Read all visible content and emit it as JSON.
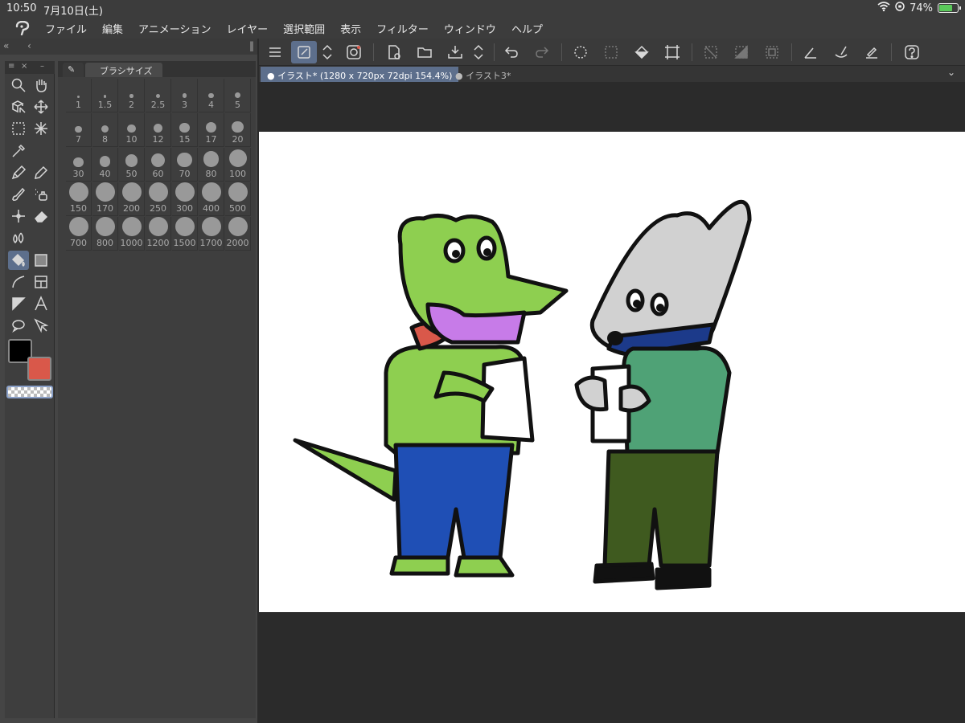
{
  "status": {
    "time": "10:50",
    "date": "7月10日(土)",
    "battery": "74%",
    "battery_level": 0.74
  },
  "menu": [
    "ファイル",
    "編集",
    "アニメーション",
    "レイヤー",
    "選択範囲",
    "表示",
    "フィルター",
    "ウィンドウ",
    "ヘルプ"
  ],
  "brush_panel": {
    "tab_label": "ブラシサイズ",
    "sizes": [
      "1",
      "1.5",
      "2",
      "2.5",
      "3",
      "4",
      "5",
      "7",
      "8",
      "10",
      "12",
      "15",
      "17",
      "20",
      "30",
      "40",
      "50",
      "60",
      "70",
      "80",
      "100",
      "150",
      "170",
      "200",
      "250",
      "300",
      "400",
      "500",
      "700",
      "800",
      "1000",
      "1200",
      "1500",
      "1700",
      "2000"
    ]
  },
  "doc_tabs": [
    {
      "label": "● イラスト* (1280 x 720px 72dpi 154.4%)",
      "active": true
    },
    {
      "label": "● イラスト3*",
      "active": false
    }
  ],
  "colors": {
    "main": "#000000",
    "sub": "#d9584a",
    "accent": "#5d6f8c"
  },
  "icons": {
    "tools": [
      "zoom",
      "hand",
      "object-select",
      "move",
      "marquee",
      "auto-select",
      "eyedropper",
      "pen",
      "pencil",
      "brush",
      "airbrush",
      "sparkle",
      "eraser",
      "blend",
      "fill",
      "gradient",
      "curve",
      "frame",
      "ruler",
      "text",
      "lasso",
      "correction"
    ],
    "toolbar": [
      "menu",
      "canvas-edit",
      "double-arrow",
      "spiral-logo",
      "new",
      "open",
      "save",
      "double-arrow",
      "undo",
      "redo",
      "loading",
      "clear-selection",
      "fill",
      "transform",
      "snap-off",
      "shade",
      "border",
      "line-tool",
      "brush-size",
      "eraser-size",
      "help"
    ]
  }
}
